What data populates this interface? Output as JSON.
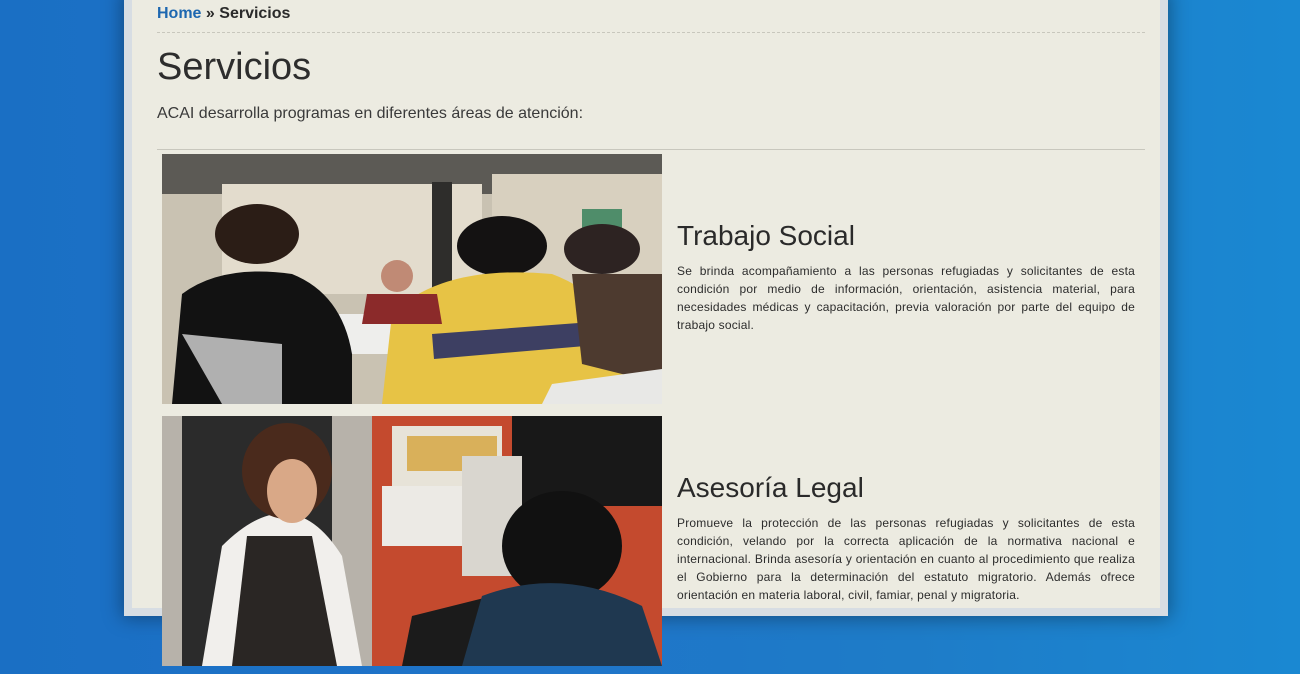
{
  "breadcrumb": {
    "home": "Home",
    "separator": "»",
    "current": "Servicios"
  },
  "page": {
    "title": "Servicios",
    "intro": "ACAI desarrolla programas en diferentes áreas de atención:"
  },
  "services": [
    {
      "title": "Trabajo Social",
      "description": "Se brinda acompañamiento a las personas refugiadas y solicitantes de esta condición por medio de información, orientación, asistencia material, para necesidades médicas y capacitación, previa valoración por parte del equipo de trabajo social."
    },
    {
      "title": "Asesoría Legal",
      "description": "Promueve la protección de las personas refugiadas y solicitantes de esta condición, velando por la correcta aplicación de la normativa nacional e internacional. Brinda asesoría y orientación en cuanto al procedimiento que realiza el Gobierno para la determinación del estatuto migratorio. Además ofrece orientación en materia laboral, civil, famiar, penal y migratoria."
    }
  ],
  "colors": {
    "link": "#1d67b0",
    "page_bg": "#ecebe1",
    "outer_bg": "#1f74c9"
  }
}
